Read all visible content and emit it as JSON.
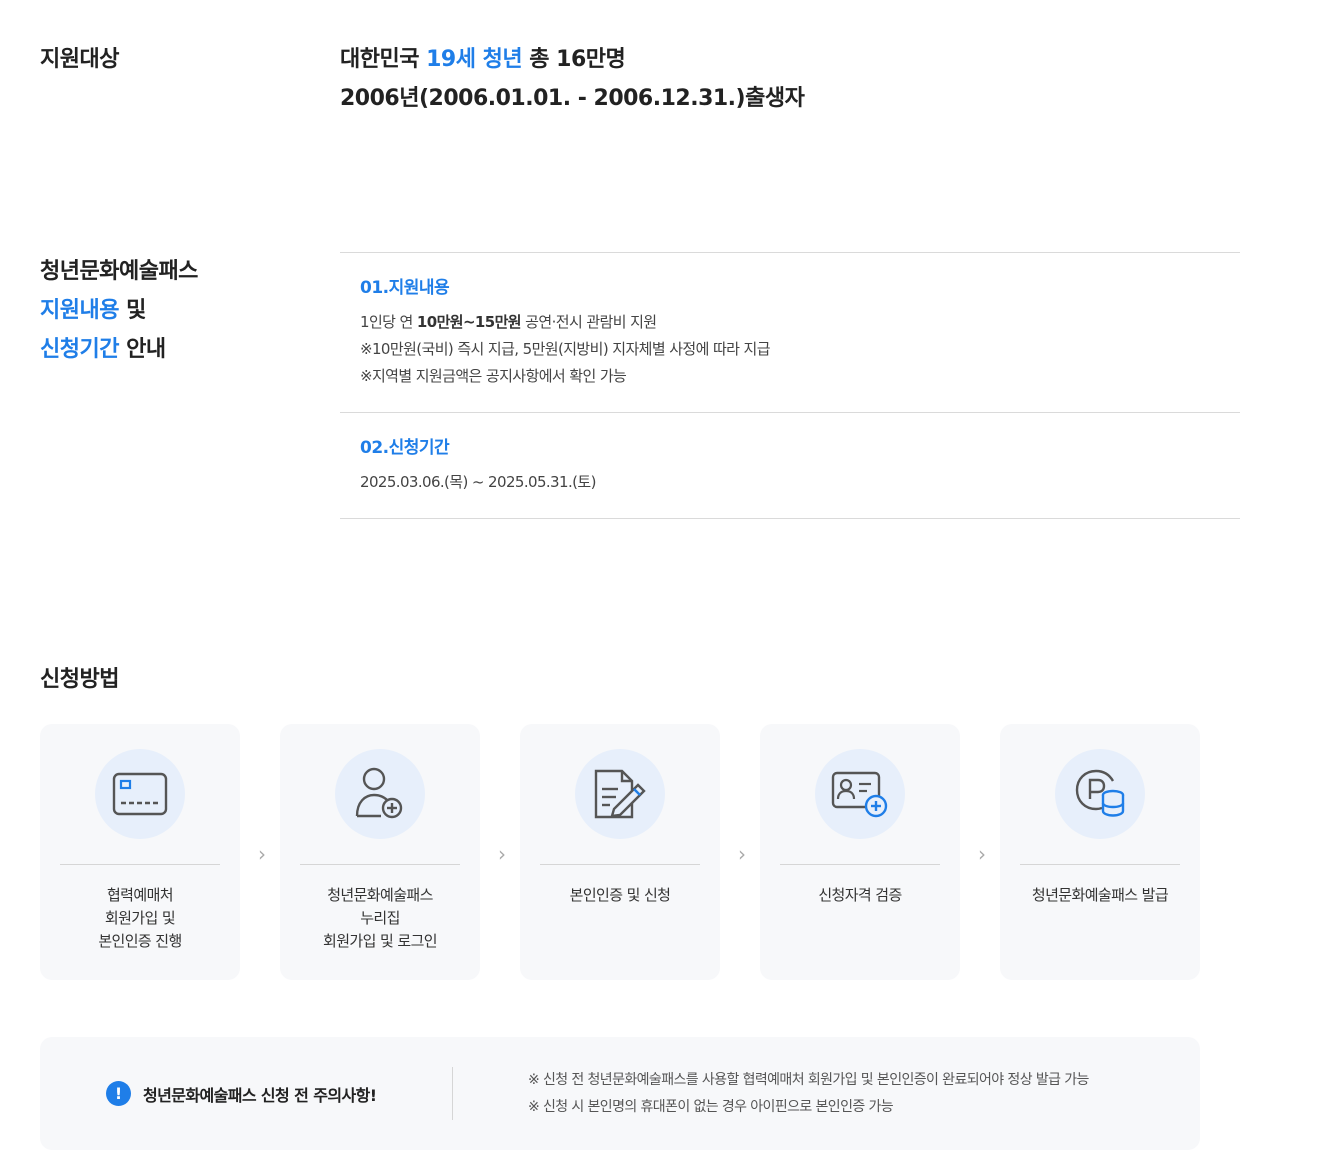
{
  "target": {
    "label": "지원대상",
    "line1_prefix": "대한민국 ",
    "line1_highlight": "19세 청년",
    "line1_suffix": " 총 16만명",
    "line2": "2006년(2006.01.01. - 2006.12.31.)출생자"
  },
  "support": {
    "label_line1": "청년문화예술패스",
    "label_line2_highlight": "지원내용",
    "label_line2_suffix": " 및",
    "label_line3_highlight": "신청기간",
    "label_line3_suffix": " 안내",
    "blocks": [
      {
        "heading": "01.지원내용",
        "line1_prefix": "1인당 연 ",
        "line1_bold": "10만원~15만원",
        "line1_suffix": " 공연·전시 관람비 지원",
        "line2": "※10만원(국비) 즉시 지급, 5만원(지방비) 지자체별 사정에 따라 지급",
        "line3": "※지역별 지원금액은 공지사항에서 확인 가능"
      },
      {
        "heading": "02.신청기간",
        "line1": "2025.03.06.(목) ~ 2025.05.31.(토)"
      }
    ]
  },
  "method": {
    "title": "신청방법",
    "steps": [
      {
        "icon": "card-icon",
        "label": "협력예매처\n회원가입 및\n본인인증 진행"
      },
      {
        "icon": "user-add-icon",
        "label": "청년문화예술패스\n누리집\n회원가입 및 로그인"
      },
      {
        "icon": "document-edit-icon",
        "label": "본인인증 및 신청"
      },
      {
        "icon": "id-card-add-icon",
        "label": "신청자격 검증"
      },
      {
        "icon": "point-coin-icon",
        "label": "청년문화예술패스 발급"
      }
    ],
    "arrow_glyph": "›"
  },
  "notice": {
    "icon_glyph": "!",
    "title": "청년문화예술패스 신청 전 주의사항!",
    "lines": [
      "※ 신청 전 청년문화예술패스를 사용할 협력예매처 회원가입 및 본인인증이 완료되어야 정상 발급 가능",
      "※ 신청 시 본인명의 휴대폰이 없는 경우 아이핀으로 본인인증 가능"
    ]
  },
  "colors": {
    "accent": "#1f7ee8",
    "icon_bg": "#e7effb",
    "card_bg": "#f7f8fa"
  }
}
